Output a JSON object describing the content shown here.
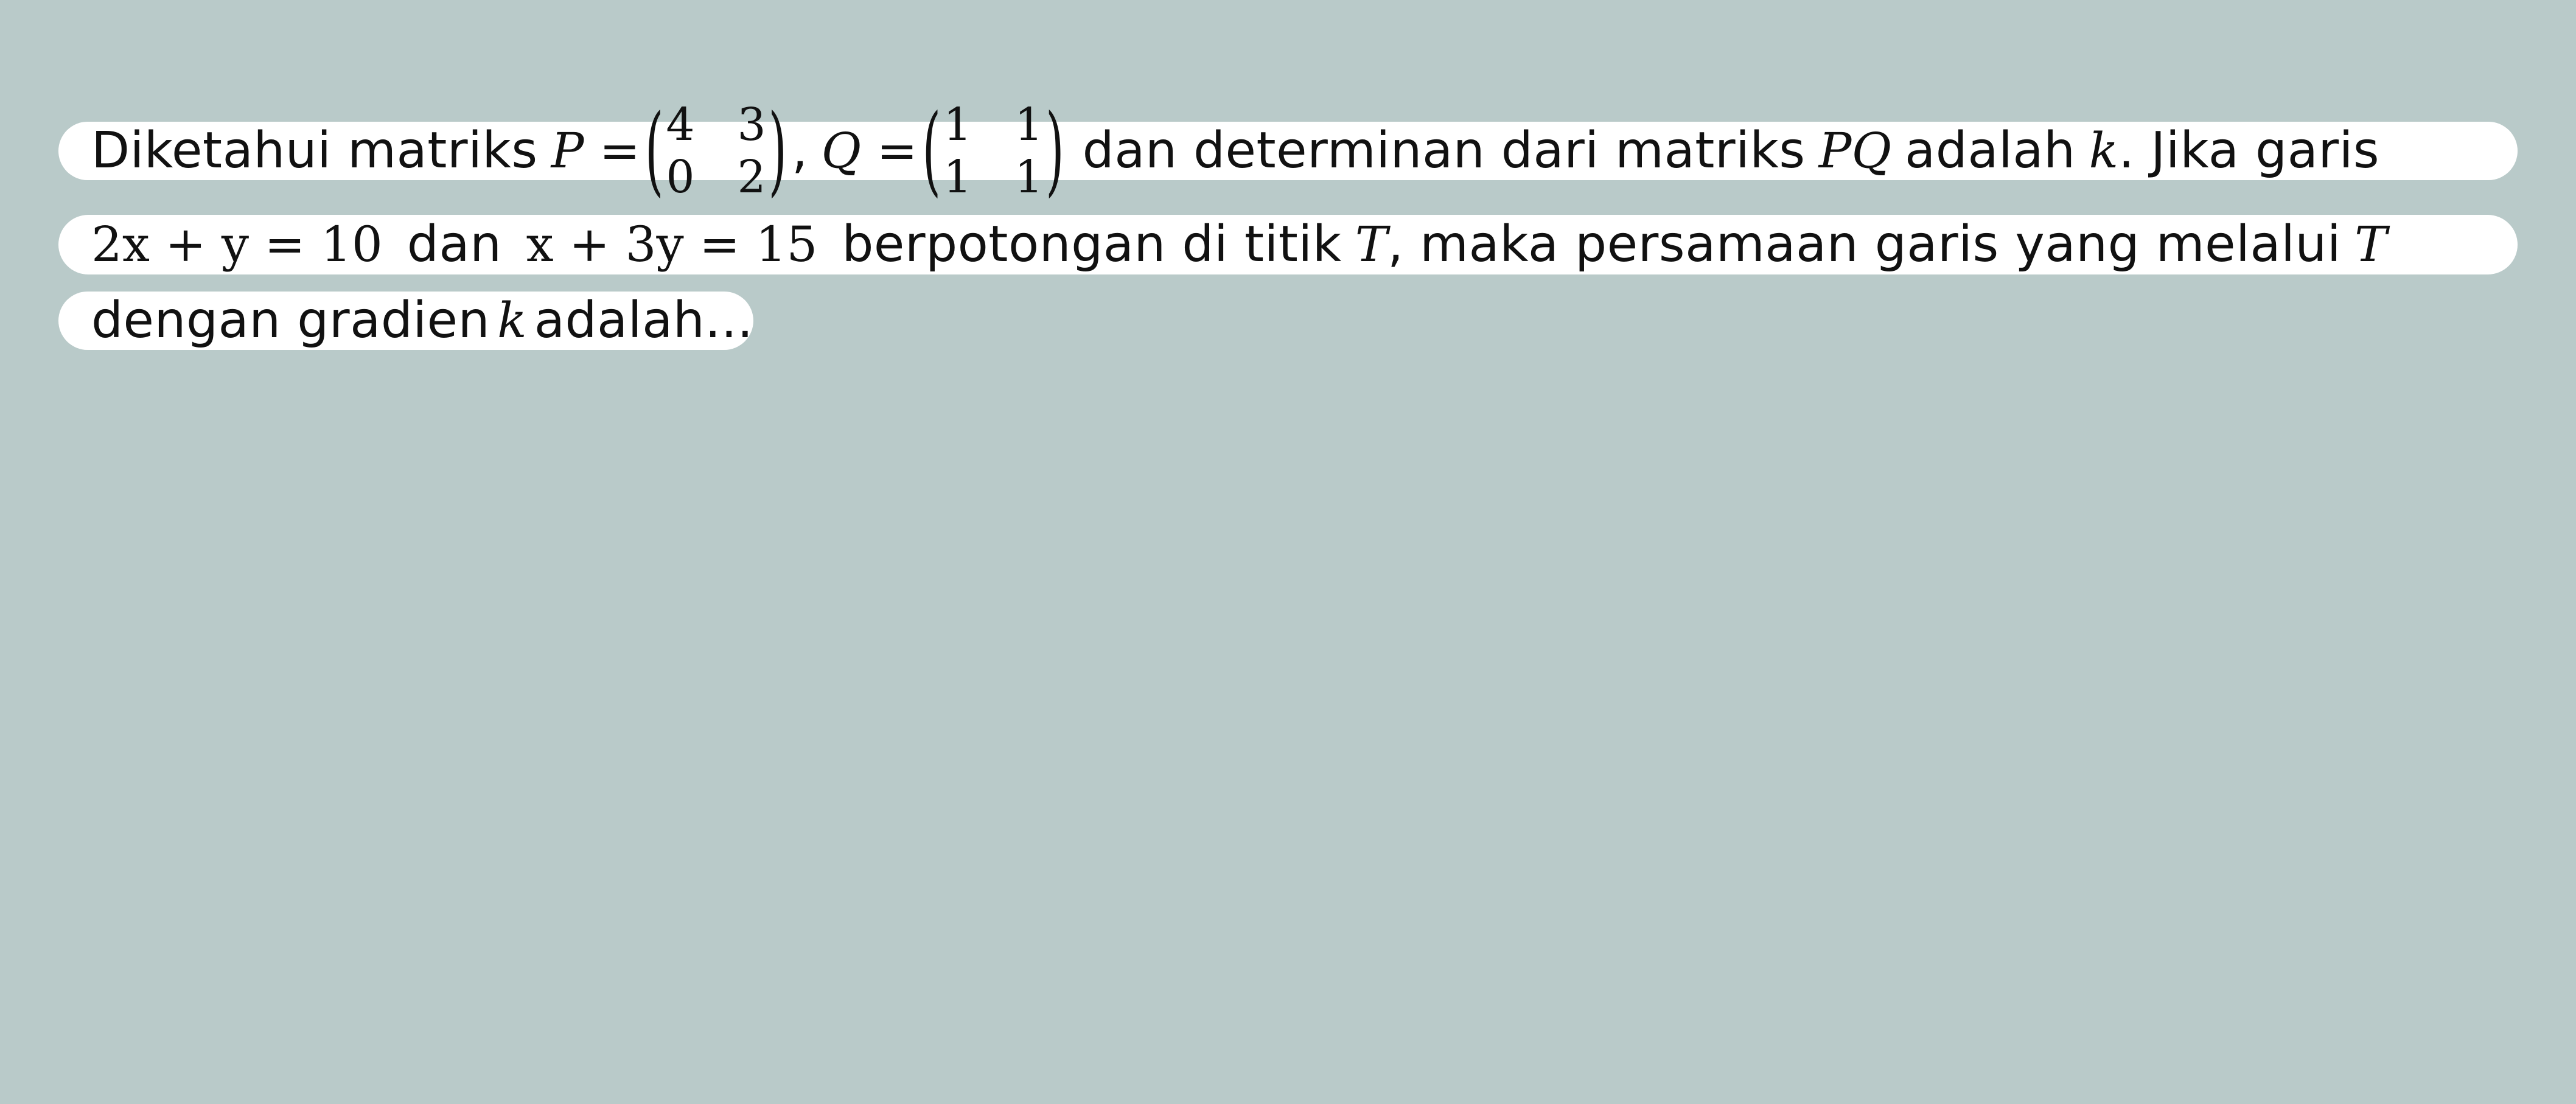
{
  "line1": {
    "t1": "Diketahui matriks",
    "p_label": "P =",
    "matrix_p": [
      "4",
      "3",
      "0",
      "2"
    ],
    "sep": ",",
    "q_label": "Q =",
    "matrix_q": [
      "1",
      "1",
      "1",
      "1"
    ],
    "t2": "dan determinan dari matriks",
    "pq": "PQ",
    "t3": "adalah",
    "k": "k",
    "t4": ". Jika garis"
  },
  "line2": {
    "eq1": "2x + y = 10",
    "t1": "dan",
    "eq2": "x + 3y = 15",
    "t2": "berpotongan di titik",
    "T1": "T",
    "t3": ", maka persamaan garis yang melalui",
    "T2": "T"
  },
  "line3": {
    "t1": "dengan gradien",
    "k": "k",
    "t2": "adalah..."
  }
}
